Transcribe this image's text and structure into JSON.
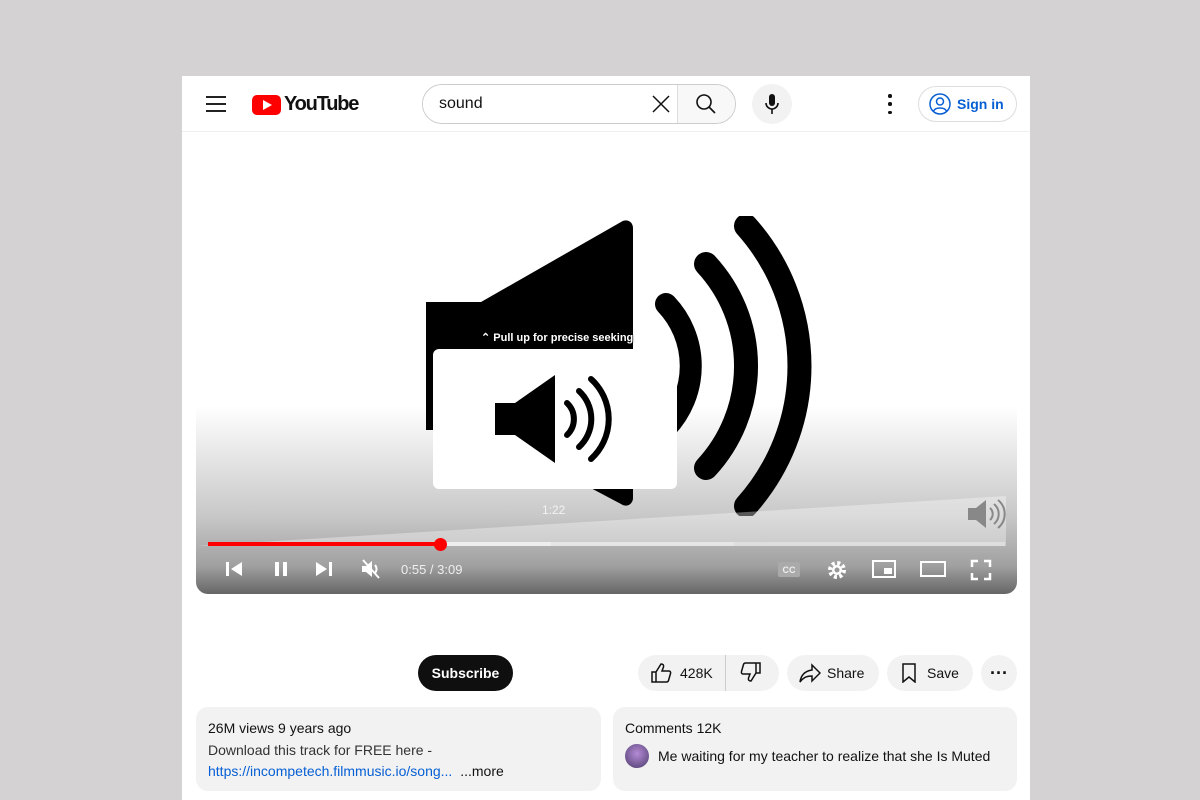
{
  "header": {
    "logo_text": "YouTube",
    "search_value": "sound",
    "sign_in": "Sign in"
  },
  "player": {
    "seek_hint": "Pull up for precise seeking",
    "preview_time": "1:22",
    "current_time": "0:55",
    "duration": "3:09",
    "time_display": "0:55 / 3:09",
    "progress_percent": 29.1,
    "buffered_percent": 43,
    "accent_color": "#ff0000"
  },
  "actions": {
    "subscribe": "Subscribe",
    "likes": "428K",
    "share": "Share",
    "save": "Save"
  },
  "description": {
    "meta": "26M views  9 years ago",
    "line1": "Download this track for FREE here -",
    "link": "https://incompetech.filmmusic.io/song...",
    "more": "...more"
  },
  "comments": {
    "title": "Comments 12K",
    "top_comment": "Me waiting for my teacher to realize that she Is Muted"
  }
}
